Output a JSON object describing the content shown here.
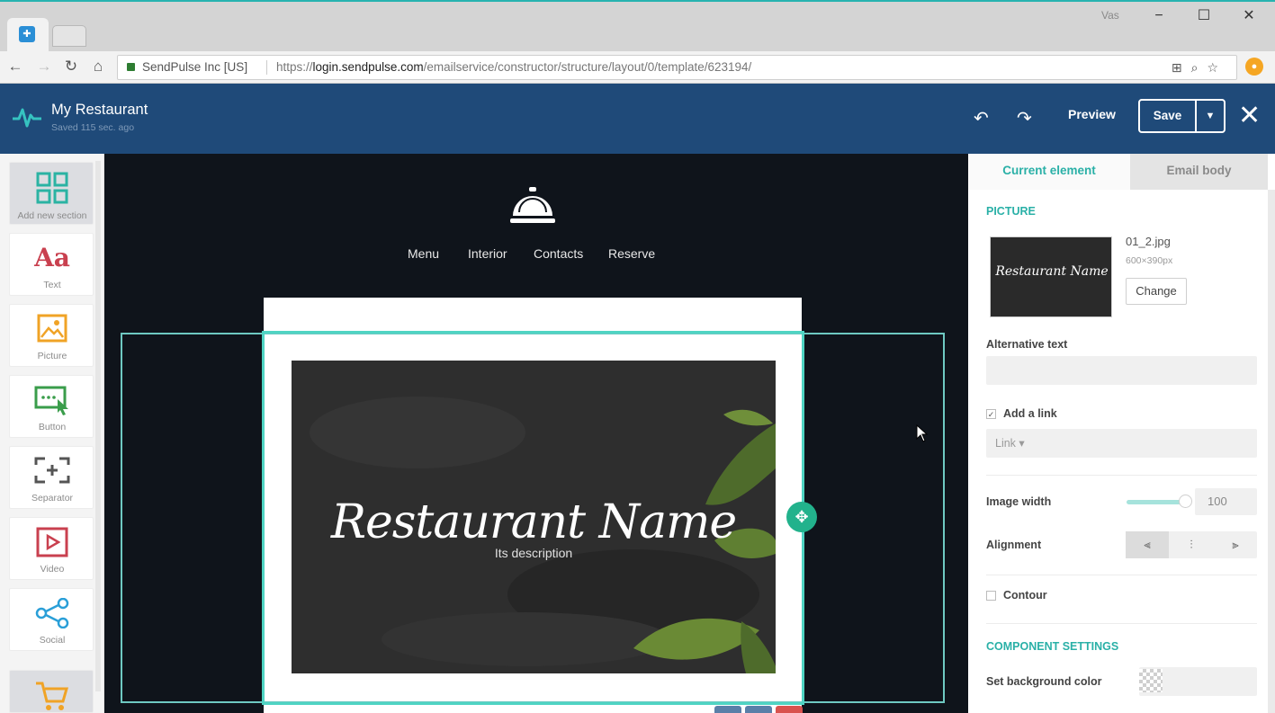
{
  "browser": {
    "user_badge": "Vas",
    "tab_favicon": "sendpulse-favicon",
    "url_secure_label": "SendPulse Inc [US]",
    "url_prefix": "https://",
    "url_host": "login.sendpulse.com",
    "url_path": "/emailservice/constructor/structure/layout/0/template/623194/"
  },
  "app": {
    "title": "My Restaurant",
    "subtitle": "Saved 115 sec. ago",
    "preview_label": "Preview",
    "save_label": "Save"
  },
  "tools": [
    {
      "label": "Add new section",
      "icon": "grid-icon"
    },
    {
      "label": "Text",
      "icon": "text-icon"
    },
    {
      "label": "Picture",
      "icon": "picture-icon"
    },
    {
      "label": "Button",
      "icon": "button-icon"
    },
    {
      "label": "Separator",
      "icon": "separator-icon"
    },
    {
      "label": "Video",
      "icon": "video-icon"
    },
    {
      "label": "Social",
      "icon": "share-icon"
    },
    {
      "label": "",
      "icon": "cart-icon"
    }
  ],
  "canvas": {
    "nav": [
      "Menu",
      "Interior",
      "Contacts",
      "Reserve"
    ],
    "hero_title": "Restaurant Name",
    "hero_description": "Its description"
  },
  "panel": {
    "tab_current": "Current element",
    "tab_body": "Email body",
    "picture_title": "PICTURE",
    "thumb_text": "Restaurant Name",
    "file_name": "01_2.jpg",
    "file_size": "600×390px",
    "change_label": "Change",
    "alt_text_label": "Alternative text",
    "alt_text_value": "",
    "add_link_label": "Add a link",
    "add_link_checked": true,
    "link_select": "Link ▾",
    "image_width_label": "Image width",
    "image_width_value": "100",
    "alignment_label": "Alignment",
    "contour_label": "Contour",
    "contour_checked": false,
    "component_settings_title": "COMPONENT SETTINGS",
    "bg_color_label": "Set background color"
  },
  "colors": {
    "header": "#1f4a79",
    "accent": "#2ab0a7",
    "canvas": "#0f141b",
    "selection": "#4fd4c3"
  }
}
